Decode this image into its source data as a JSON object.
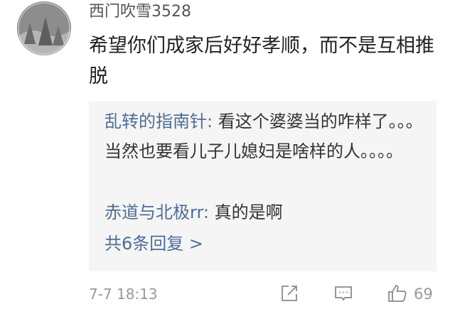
{
  "comment": {
    "username": "西门吹雪3528",
    "text": "希望你们成家后好好孝顺，而不是互相推脱",
    "timestamp": "7-7 18:13",
    "like_count": "69"
  },
  "replies": [
    {
      "author": "乱转的指南针:",
      "text": " 看这个婆婆当的咋样了。。。当然也要看儿子儿媳妇是啥样的人。。。。"
    },
    {
      "author": "赤道与北极rr:",
      "text": " 真的是啊"
    }
  ],
  "more_replies": "共6条回复 >",
  "icons": {
    "share": "share-icon",
    "reply": "comment-icon",
    "like": "thumbs-up-icon"
  },
  "colors": {
    "link": "#4e6d98",
    "meta": "#999999",
    "reply_bg": "#f5f5f5"
  }
}
